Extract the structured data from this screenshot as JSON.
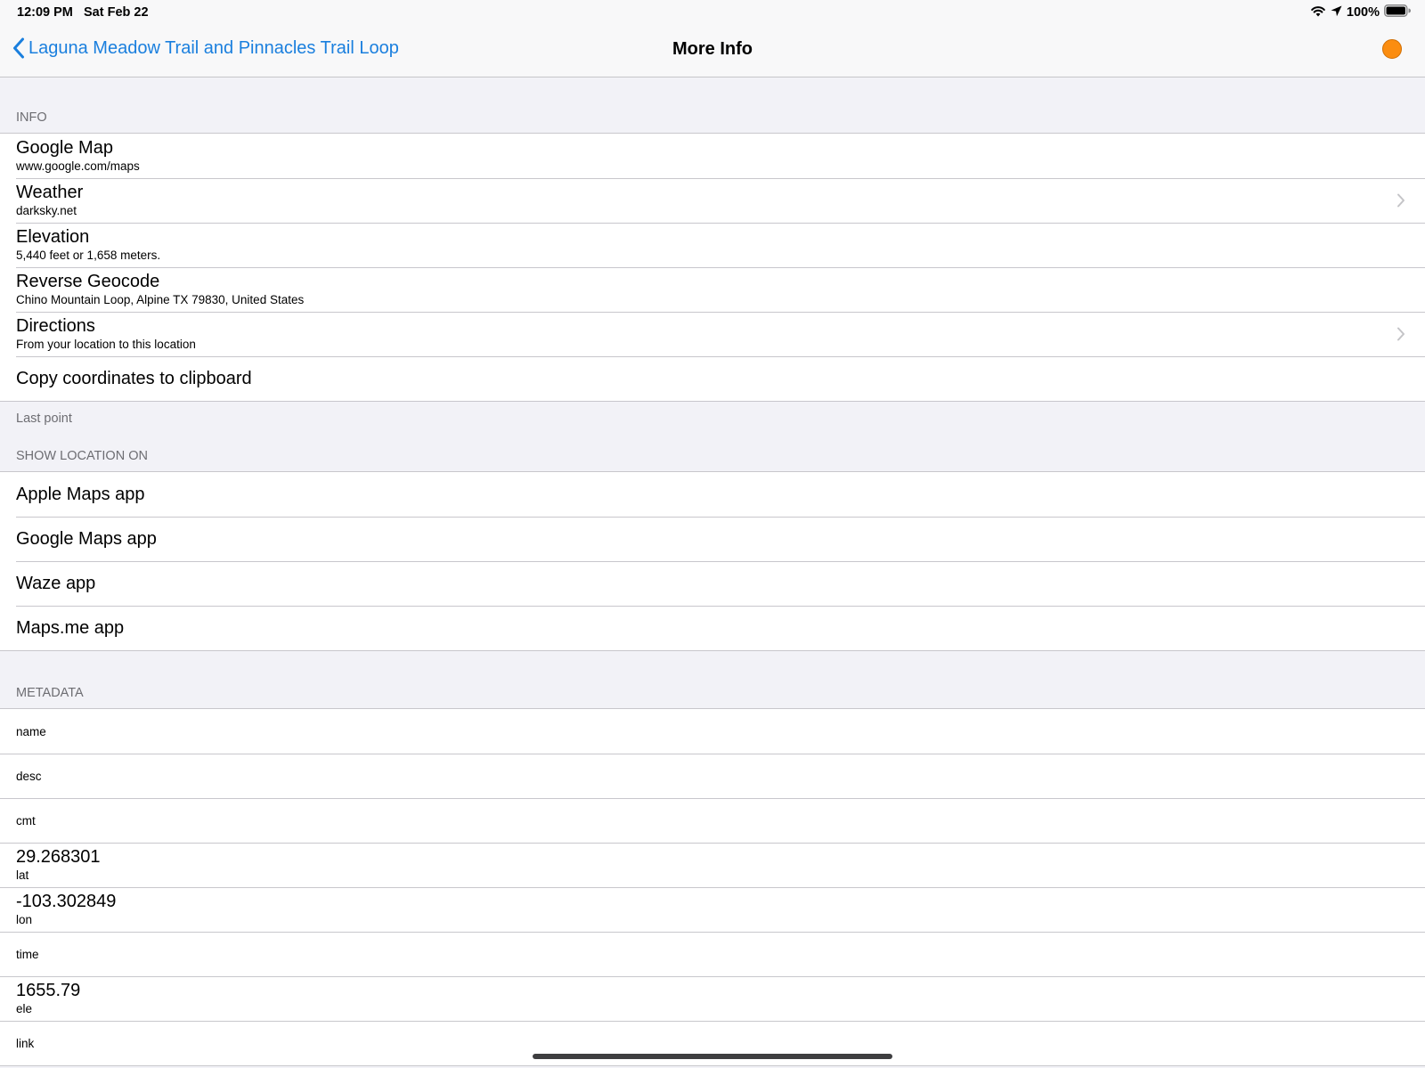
{
  "status_bar": {
    "time": "12:09 PM",
    "date": "Sat Feb 22",
    "battery": "100%"
  },
  "nav": {
    "back_label": "Laguna Meadow Trail and Pinnacles Trail Loop",
    "title": "More Info",
    "accent_color": "#fb8d10"
  },
  "info": {
    "header": "INFO",
    "items": [
      {
        "title": "Google Map",
        "subtitle": "www.google.com/maps"
      },
      {
        "title": "Weather",
        "subtitle": "darksky.net"
      },
      {
        "title": "Elevation",
        "subtitle": "5,440 feet or 1,658 meters."
      },
      {
        "title": "Reverse Geocode",
        "subtitle": "Chino Mountain Loop, Alpine TX 79830, United States"
      },
      {
        "title": "Directions",
        "subtitle": "From your location to this location"
      },
      {
        "title": "Copy coordinates to clipboard"
      }
    ],
    "footer": "Last point"
  },
  "show_location": {
    "header": "SHOW LOCATION ON",
    "items": [
      "Apple Maps app",
      "Google Maps app",
      "Waze app",
      "Maps.me app"
    ]
  },
  "metadata": {
    "header": "METADATA",
    "rows": [
      {
        "label": "name"
      },
      {
        "label": "desc"
      },
      {
        "label": "cmt"
      },
      {
        "value": "29.268301",
        "label": "lat"
      },
      {
        "value": "-103.302849",
        "label": "lon"
      },
      {
        "label": "time"
      },
      {
        "value": "1655.79",
        "label": "ele"
      },
      {
        "label": "link"
      }
    ]
  }
}
